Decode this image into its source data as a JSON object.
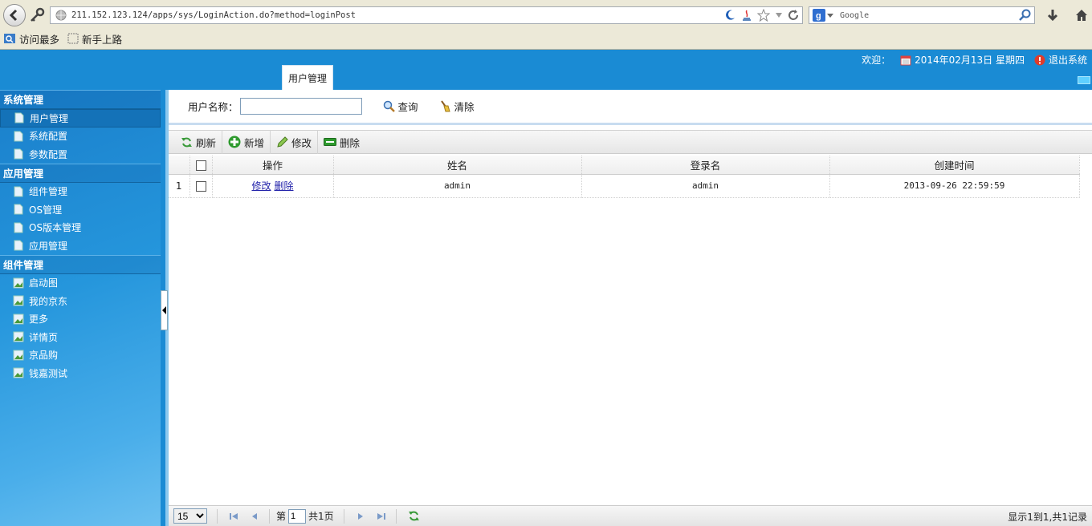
{
  "browser": {
    "url": "211.152.123.124/apps/sys/LoginAction.do?method=loginPost",
    "search_placeholder": "Google",
    "bookmarks": [
      "访问最多",
      "新手上路"
    ]
  },
  "header": {
    "active_tab": "用户管理",
    "welcome": "欢迎：",
    "date": "2014年02月13日 星期四",
    "logout": "退出系统"
  },
  "sidebar": {
    "sections": [
      {
        "title": "系统管理",
        "items": [
          "用户管理",
          "系统配置",
          "参数配置"
        ]
      },
      {
        "title": "应用管理",
        "items": [
          "组件管理",
          "OS管理",
          "OS版本管理",
          "应用管理"
        ]
      },
      {
        "title": "组件管理",
        "items": [
          "启动图",
          "我的京东",
          "更多",
          "详情页",
          "京品购",
          "钱嘉测试"
        ]
      }
    ]
  },
  "search": {
    "label": "用户名称：",
    "value": "",
    "query_button": "查询",
    "clear_button": "清除"
  },
  "toolbar": {
    "refresh": "刷新",
    "add": "新增",
    "edit": "修改",
    "delete": "删除"
  },
  "table": {
    "columns": [
      "操作",
      "姓名",
      "登录名",
      "创建时间"
    ],
    "rows": [
      {
        "index": "1",
        "actions": [
          "修改",
          "删除"
        ],
        "name": "admin",
        "login": "admin",
        "created": "2013-09-26 22:59:59"
      }
    ]
  },
  "pager": {
    "page_size": "15",
    "page_prefix": "第",
    "page_value": "1",
    "page_suffix": "共1页",
    "info": "显示1到1,共1记录"
  },
  "colors": {
    "header_blue": "#1a8bd4",
    "sidebar_blue": "#2596dc",
    "link": "#2222aa"
  }
}
